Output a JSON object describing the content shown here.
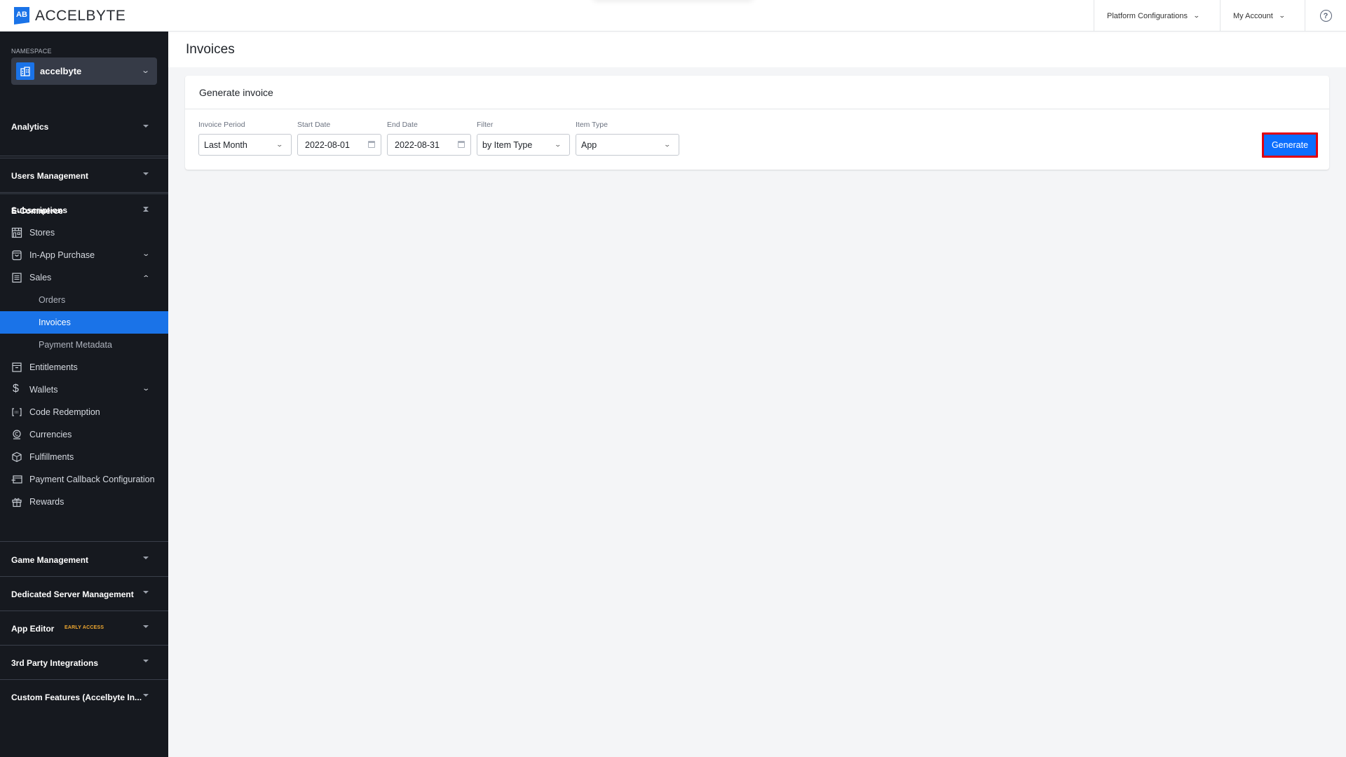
{
  "header": {
    "brand": "ACCELBYTE",
    "logo_glyph": "AB",
    "menus": [
      {
        "label": "Platform Configurations",
        "icon": "chevron-down-icon"
      },
      {
        "label": "My Account",
        "icon": "chevron-down-icon"
      }
    ],
    "help_icon": "?"
  },
  "sidebar": {
    "namespace_label": "NAMESPACE",
    "namespace_value": "accelbyte",
    "sections_top": [
      {
        "label": "Analytics",
        "expanded": false
      },
      {
        "label": "Users Management",
        "expanded": false
      },
      {
        "label": "Subscriptions",
        "expanded": false
      }
    ],
    "ecommerce": {
      "label": "E-Commerce",
      "expanded": true,
      "items": [
        {
          "label": "Stores",
          "icon": "store-icon"
        },
        {
          "label": "In-App Purchase",
          "icon": "shopping-bag-icon",
          "expandable": true,
          "expanded": false
        },
        {
          "label": "Sales",
          "icon": "receipt-icon",
          "expandable": true,
          "expanded": true
        },
        {
          "label": "Orders",
          "sub": true
        },
        {
          "label": "Invoices",
          "sub": true,
          "active": true
        },
        {
          "label": "Payment Metadata",
          "sub": true
        },
        {
          "label": "Entitlements",
          "icon": "archive-icon"
        },
        {
          "label": "Wallets",
          "icon": "dollar-icon",
          "expandable": true,
          "expanded": false
        },
        {
          "label": "Code Redemption",
          "icon": "code-brackets-icon"
        },
        {
          "label": "Currencies",
          "icon": "coin-icon"
        },
        {
          "label": "Fulfillments",
          "icon": "package-icon"
        },
        {
          "label": "Payment Callback Configuration",
          "icon": "card-callback-icon"
        },
        {
          "label": "Rewards",
          "icon": "gift-icon"
        }
      ]
    },
    "sections_bottom": [
      {
        "label": "Game Management"
      },
      {
        "label": "Dedicated Server Management"
      },
      {
        "label": "App Editor",
        "badge": "EARLY ACCESS"
      },
      {
        "label": "3rd Party Integrations"
      },
      {
        "label": "Custom Features (Accelbyte In..."
      }
    ]
  },
  "main": {
    "page_title": "Invoices",
    "card_title": "Generate invoice",
    "fields": {
      "invoice_period": {
        "label": "Invoice Period",
        "value": "Last Month"
      },
      "start_date": {
        "label": "Start Date",
        "value": "2022-08-01"
      },
      "end_date": {
        "label": "End Date",
        "value": "2022-08-31"
      },
      "filter": {
        "label": "Filter",
        "value": "by Item Type"
      },
      "item_type": {
        "label": "Item Type",
        "value": "App"
      }
    },
    "generate_label": "Generate"
  },
  "colors": {
    "accent": "#1a73e8",
    "button": "#0c6efd",
    "highlight_border": "#e00010",
    "sidebar_bg": "#16191f",
    "badge": "#f0a830"
  }
}
